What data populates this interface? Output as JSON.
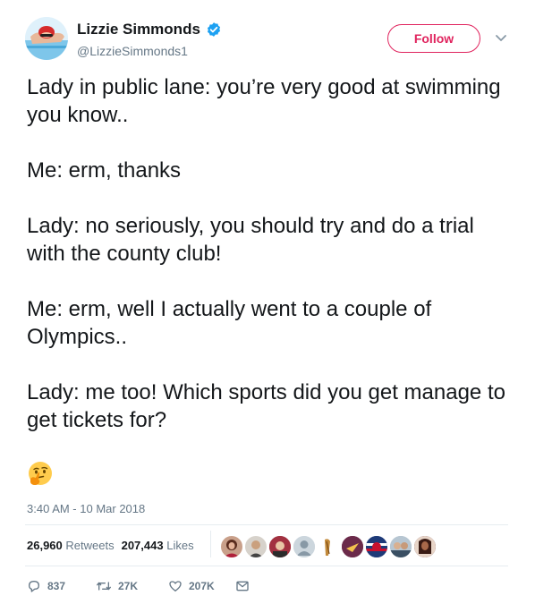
{
  "author": {
    "name": "Lizzie Simmonds",
    "handle": "@LizzieSimmonds1",
    "avatar_icon": "profile-photo-swimmer",
    "verified_icon": "verified-badge-icon"
  },
  "follow_button": {
    "label": "Follow",
    "color": "#e0245e"
  },
  "tweet": {
    "paragraphs": [
      "Lady in public lane: you’re very good at swimming you know..",
      "Me: erm, thanks",
      "Lady: no seriously, you should try and do a trial with the county club!",
      "Me: erm, well I actually went to a couple of Olympics..",
      "Lady: me too! Which sports did you get manage to get tickets for?"
    ],
    "emoji": "thinking-face-emoji"
  },
  "timestamp": "3:40 AM - 10 Mar 2018",
  "stats": {
    "retweets_count": "26,960",
    "retweets_label": "Retweets",
    "likes_count": "207,443",
    "likes_label": "Likes"
  },
  "actions": {
    "reply_count": "837",
    "retweet_count": "27K",
    "like_count": "207K"
  },
  "colors": {
    "text": "#14171a",
    "secondary": "#657786",
    "divider": "#e6ecf0",
    "verified": "#1da1f2",
    "accent": "#e0245e"
  }
}
